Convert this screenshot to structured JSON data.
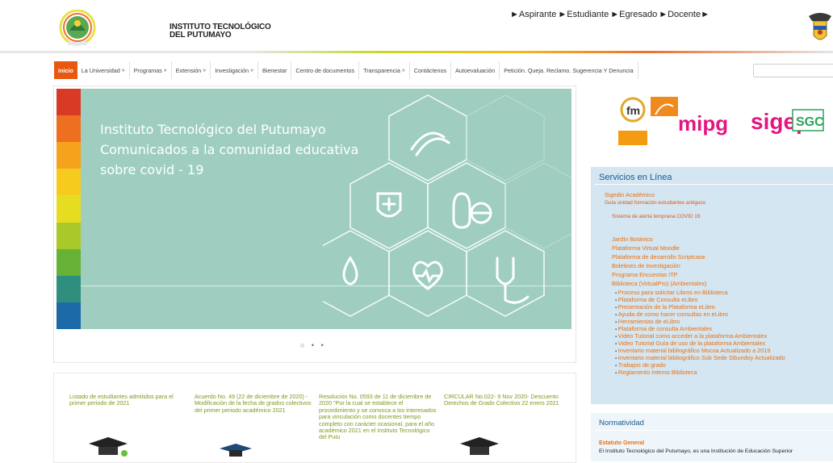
{
  "header": {
    "institution_line1": "INSTITUTO TECNOLÓGICO",
    "institution_line2": "DEL PUTUMAYO",
    "quicklinks": [
      "►Aspirante",
      "►Estudiante",
      "►Egresado",
      "►Docente►"
    ]
  },
  "nav": {
    "items": [
      {
        "label": "Inicio",
        "active": true,
        "dropdown": false
      },
      {
        "label": "La Universidad",
        "dropdown": true
      },
      {
        "label": "Programas",
        "dropdown": true
      },
      {
        "label": "Extensión",
        "dropdown": true
      },
      {
        "label": "Investigación",
        "dropdown": true
      },
      {
        "label": "Bienestar",
        "dropdown": false
      },
      {
        "label": "Centro de documentos",
        "dropdown": false
      },
      {
        "label": "Transparencia",
        "dropdown": true
      },
      {
        "label": "Contáctenos",
        "dropdown": false
      },
      {
        "label": "Autoevaluación",
        "dropdown": false
      },
      {
        "label": "Petición. Queja. Reclamo. Sugerencia Y Denuncia",
        "dropdown": false
      }
    ],
    "chevron": "»",
    "accent": "#e8580f"
  },
  "slider": {
    "line1": "Instituto Tecnológico del Putumayo",
    "line2": "Comunicados a la comunidad educativa",
    "line3": "sobre covid - 19",
    "dots": "○ • •",
    "colors": [
      "#d93a26",
      "#ee6f1f",
      "#f5a21d",
      "#f6cb1d",
      "#e6dd21",
      "#a9c92a",
      "#66b237",
      "#2e8f7f",
      "#1d6aa8"
    ]
  },
  "news": [
    {
      "text": "Listado de estudiantes admitidos para el primer periodo de 2021"
    },
    {
      "text": "Acuerdo No. 49 (22 de diciembre de 2020) - Modificación de la fecha de grados colectivos del primer periodo académico 2021"
    },
    {
      "text": "Resolución No. 0593 de 11 de diciembre de 2020 \"Por la cual se establece el procedimiento y se convoca a los interesados para vinculación como docentes tiempo completo con carácter ocasional, para el año académico 2021 en el Instituto Tecnológico del Putu"
    },
    {
      "text": "CIRCULAR No.022- 9 Nov 2020- Descuento Derechos de Grado Colectivo 22 enero 2021"
    }
  ],
  "servicios": {
    "title": "Servicios en Línea",
    "sigedin": "Sigedin Académico",
    "guia": "Guía unidad formación estudiantes antiguos",
    "alerta": "Sistema de alerta temprana COVID 19",
    "links": [
      "Jardín Botánico",
      "Plataforma Virtual Moodle",
      "Plataforma de desarrollo Scriptcase",
      "Boletines de Investigación",
      "Programa Encuestas ITP",
      "Biblioteca (VirtualPro) (Ambientalex)"
    ],
    "bullets": [
      "Proceso para solicitar Libros en Biblioteca",
      "Plataforma de Consulta eLibro",
      "Presentación de la Plataforma eLibro",
      "Ayuda de como hacer consultas en eLibro",
      "Herramientas de eLibro",
      "Plataforma de consulta Ambientalex",
      "Video Tutorial como acceder a la plataforma Ambientalex",
      "Video Tutorial Guía de uso de la plataforma Ambientalex",
      "Inventario material bibliográfico Mocoa Actualizado a 2019",
      "Inventario material bibliográfico Sub Sede Sibundoy Actualizado",
      "Trabajos de grado",
      "Reglamento Interno Biblioteca"
    ]
  },
  "logos": {
    "mipg": "mipg",
    "sigep": "sigep",
    "sgc": "SGC",
    "fm": "fm"
  },
  "normatividad": {
    "title": "Normatividad",
    "estatuto": "Estatuto General",
    "estatuto_text": "El Instituto Tecnológico del Putumayo, es una Institución de Educación Superior"
  }
}
